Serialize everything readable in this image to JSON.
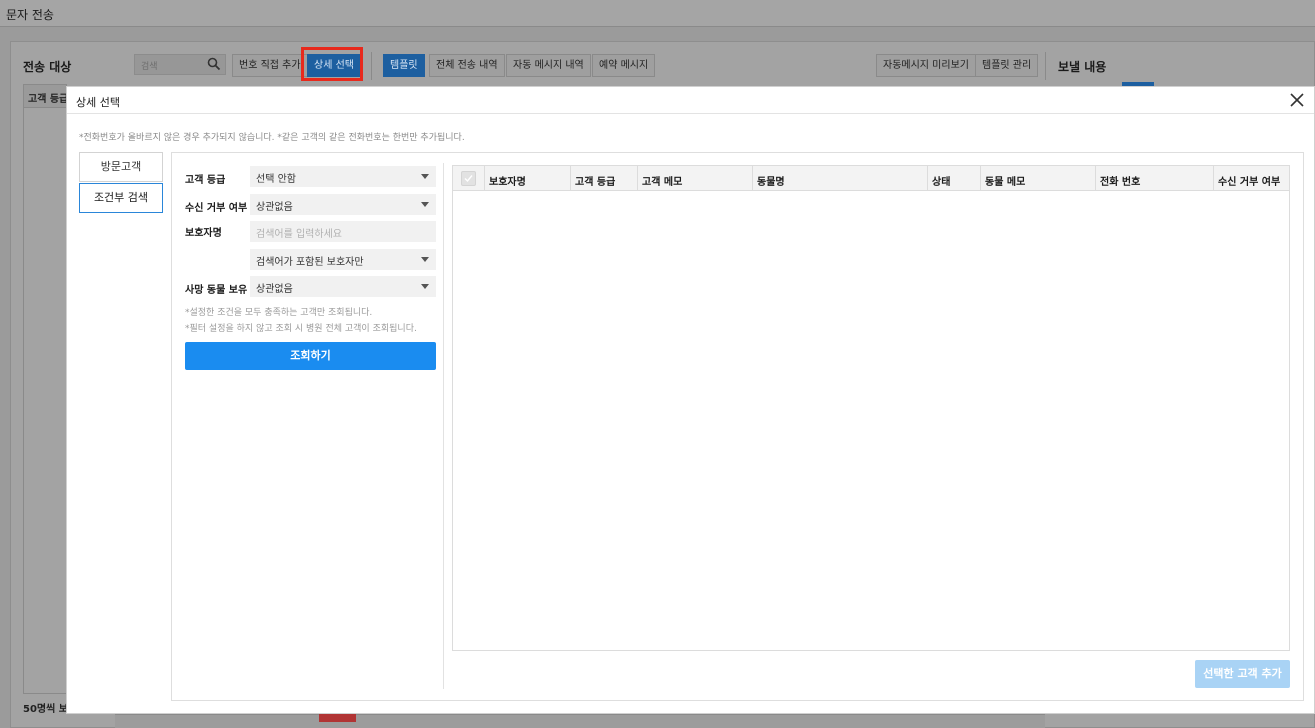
{
  "background": {
    "page_title": "문자 전송",
    "section_target": "전송 대상",
    "section_send": "보낼 내용",
    "search_placeholder": "검색",
    "btn_add_number": "번호 직접 추가",
    "btn_detail_select": "상세 선택",
    "btn_template": "템플릿",
    "btn_all_history": "전체 전송 내역",
    "btn_auto_history": "자동 메시지 내역",
    "btn_reserved": "예약 메시지",
    "btn_auto_preview": "자동메시지 미리보기",
    "btn_template_manage": "템플릿 관리",
    "grade_header": "고객 등급",
    "bottom_text": "50명씩 보"
  },
  "modal": {
    "title": "상세 선택",
    "notice": "*전화번호가 올바르지 않은 경우 추가되지 않습니다. *같은 고객의 같은 전화번호는 한번만 추가됩니다.",
    "tabs": [
      "방문고객",
      "조건부 검색"
    ],
    "active_tab": "조건부 검색",
    "filters": {
      "grade_label": "고객 등급",
      "grade_value": "선택 안함",
      "reject_label": "수신 거부 여부",
      "reject_value": "상관없음",
      "guardian_label": "보호자명",
      "guardian_placeholder": "검색어를 입력하세요",
      "guardian_mode": "검색어가 포함된 보호자만",
      "deceased_label": "사망 동물 보유",
      "deceased_value": "상관없음"
    },
    "hints": [
      "*설정한 조건을 모두 충족하는 고객만 조회됩니다.",
      "*필터 설정을 하지 않고 조회 시 병원 전체 고객이 조회됩니다."
    ],
    "search_button": "조회하기",
    "table_headers": [
      "보호자명",
      "고객 등급",
      "고객 메모",
      "동물명",
      "상태",
      "동물 메모",
      "전화 번호",
      "수신 거부 여부"
    ],
    "add_button": "선택한 고객 추가"
  },
  "colors": {
    "primary": "#1a8cf0",
    "primary_disabled": "#a9d3f5",
    "highlight": "#e8291c",
    "overlay": "#9b9b9b"
  }
}
